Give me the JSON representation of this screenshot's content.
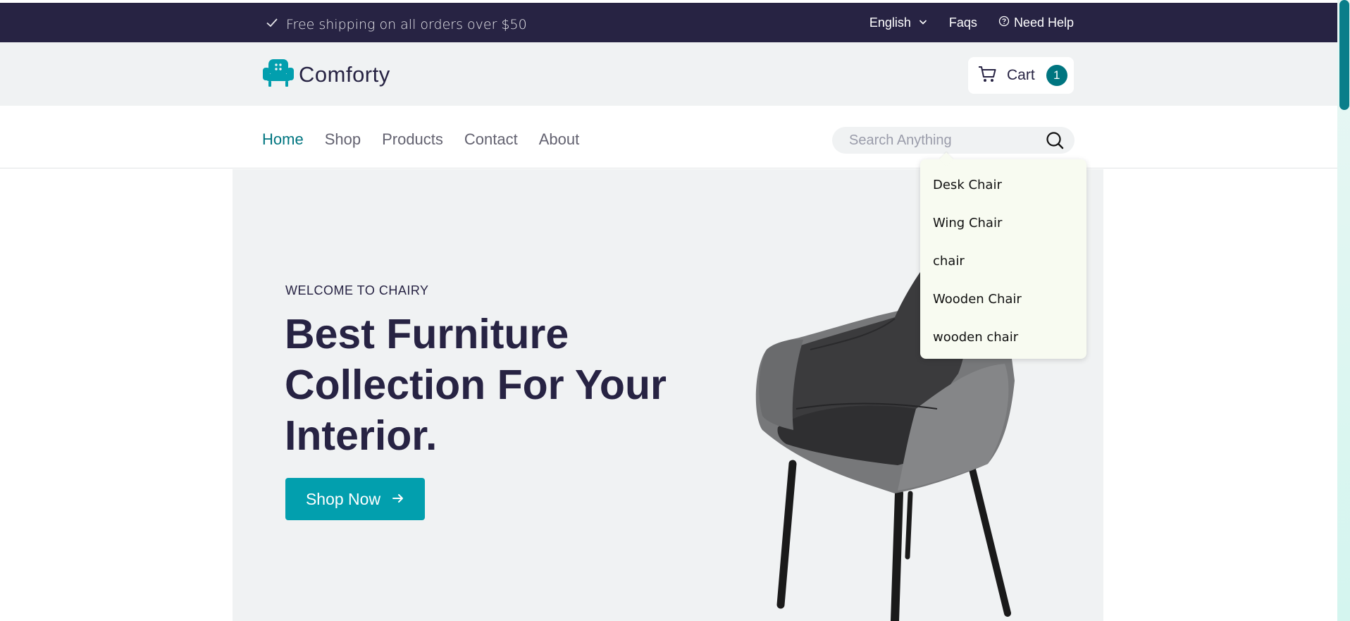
{
  "topbar": {
    "shipping_text": "Free shipping on all orders over $50",
    "language": "English",
    "faqs": "Faqs",
    "need_help": "Need Help"
  },
  "brand": {
    "name": "Comforty",
    "icon": "armchair-logo-icon",
    "color": "#029fae"
  },
  "cart": {
    "label": "Cart",
    "count": "1"
  },
  "nav": {
    "items": [
      {
        "label": "Home",
        "active": true
      },
      {
        "label": "Shop",
        "active": false
      },
      {
        "label": "Products",
        "active": false
      },
      {
        "label": "Contact",
        "active": false
      },
      {
        "label": "About",
        "active": false
      }
    ]
  },
  "search": {
    "placeholder": "Search Anything",
    "value": ""
  },
  "suggestions": [
    "Desk Chair",
    "Wing Chair",
    "chair",
    "Wooden Chair",
    "wooden chair"
  ],
  "hero": {
    "eyebrow": "WELCOME TO CHAIRY",
    "title": "Best Furniture Collection For Your Interior.",
    "cta": "Shop Now"
  },
  "colors": {
    "topbar_bg": "#272343",
    "accent": "#029fae",
    "nav_active": "#007580",
    "text_dark": "#272343"
  }
}
